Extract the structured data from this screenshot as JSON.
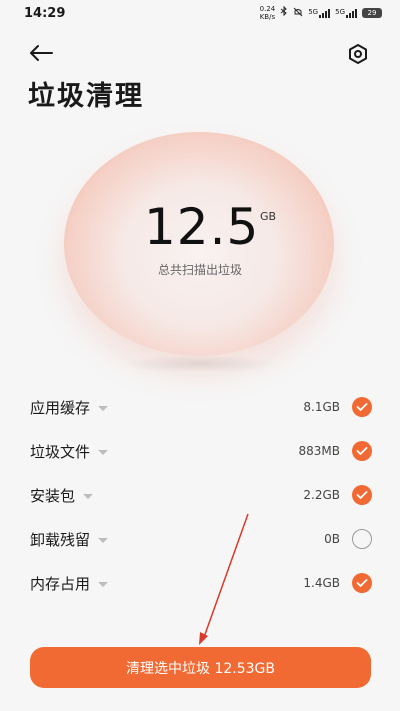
{
  "status_bar": {
    "time": "14:29",
    "net_speed_value": "0.24",
    "net_speed_unit": "KB/s",
    "sim1_label": "5G",
    "sim2_label": "5G",
    "battery": "29"
  },
  "header": {
    "title": "垃圾清理"
  },
  "summary": {
    "value": "12.5",
    "unit": "GB",
    "caption": "总共扫描出垃圾"
  },
  "items": [
    {
      "label": "应用缓存",
      "size": "8.1GB",
      "checked": true
    },
    {
      "label": "垃圾文件",
      "size": "883MB",
      "checked": true
    },
    {
      "label": "安装包",
      "size": "2.2GB",
      "checked": true
    },
    {
      "label": "卸载残留",
      "size": "0B",
      "checked": false
    },
    {
      "label": "内存占用",
      "size": "1.4GB",
      "checked": true
    }
  ],
  "actions": {
    "clean_label": "清理选中垃圾 12.53GB"
  },
  "colors": {
    "accent": "#f26a33",
    "annotation": "#d93a2b"
  },
  "icons": {
    "back": "arrow-left-icon",
    "settings": "hexagon-gear-icon",
    "check": "check-icon",
    "caret": "caret-down-icon"
  }
}
